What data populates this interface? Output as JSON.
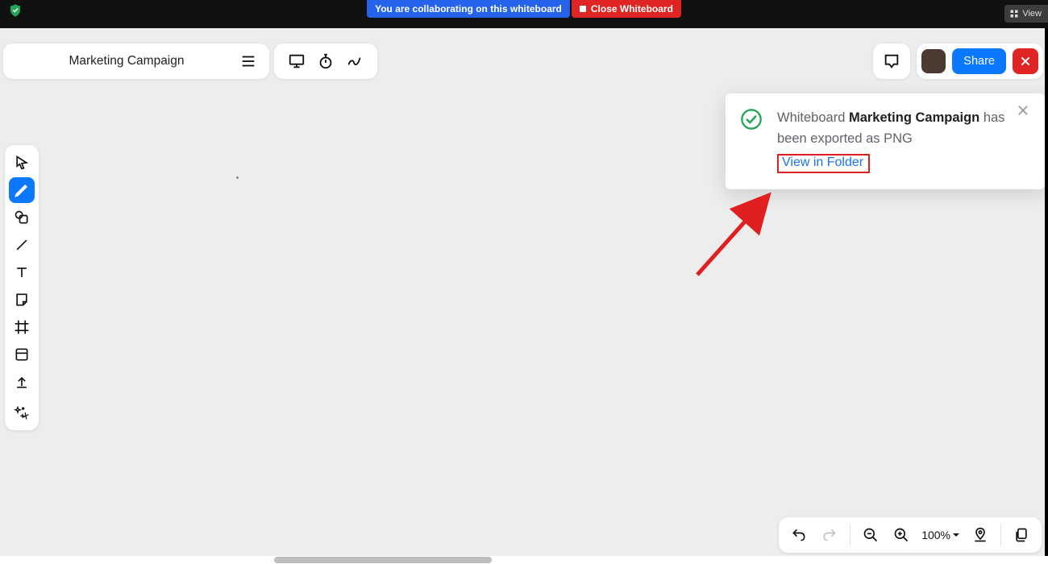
{
  "topbar": {
    "collab_text": "You are collaborating on this whiteboard",
    "close_wb_label": "Close Whiteboard",
    "view_label": "View"
  },
  "title_card": {
    "title": "Marketing Campaign"
  },
  "share_button_label": "Share",
  "toast": {
    "prefix": "Whiteboard ",
    "name": "Marketing Campaign",
    "suffix": " has been exported as PNG",
    "link_label": "View in Folder"
  },
  "zoom": {
    "label": "100%"
  },
  "tools": {
    "select": "select-tool",
    "pen": "pen-tool",
    "shape": "shape-tool",
    "line": "line-tool",
    "text": "text-tool",
    "sticky": "sticky-note-tool",
    "frame": "frame-tool",
    "table": "table-tool",
    "upload": "upload-tool",
    "more": "more-apps-tool"
  }
}
